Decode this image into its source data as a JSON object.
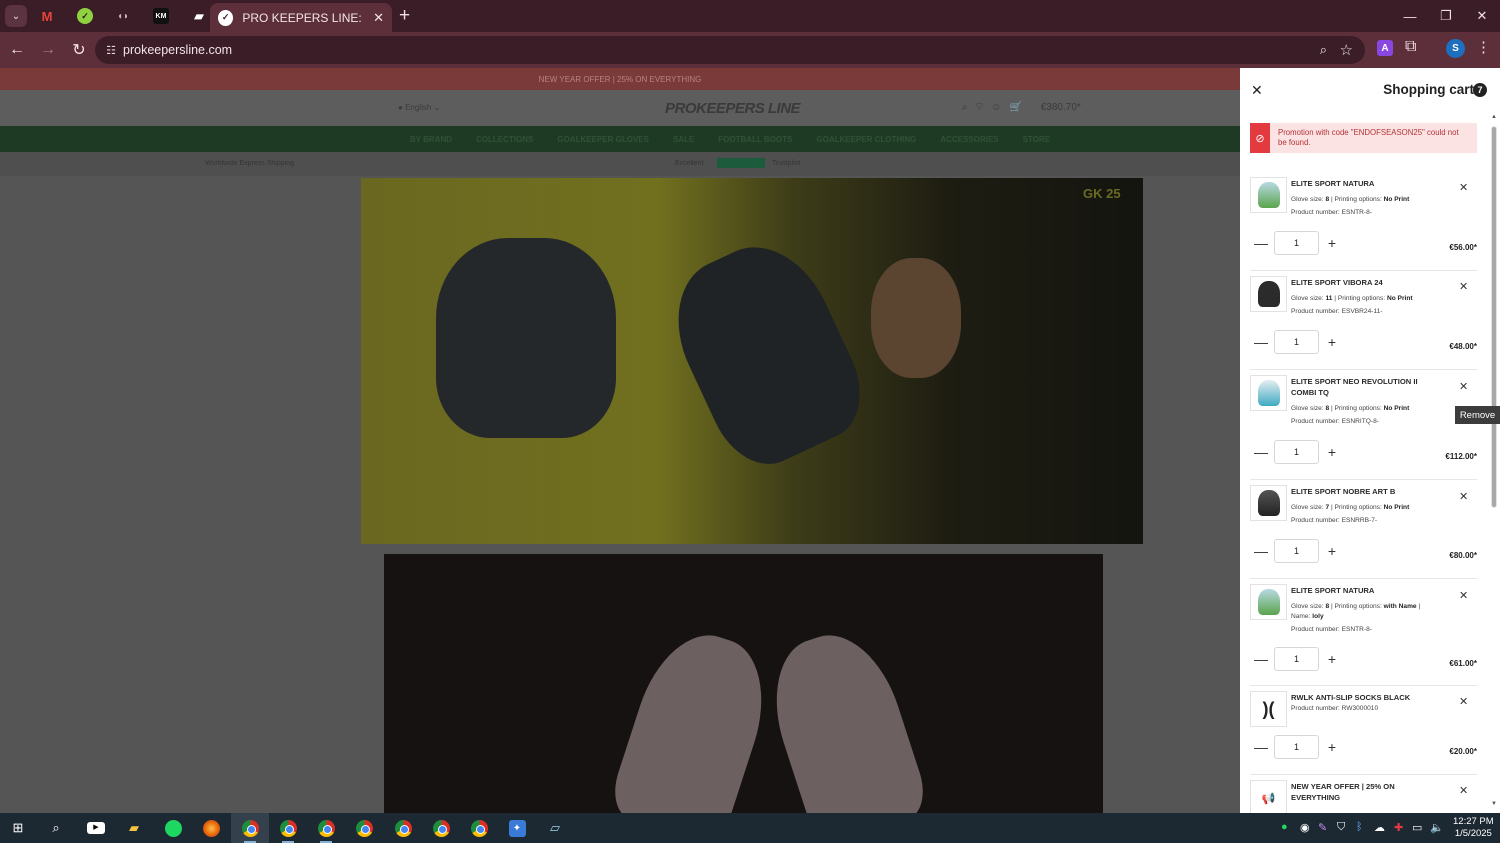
{
  "browser": {
    "active_tab_title": "PRO KEEPERS LINE: Goalkeeper",
    "url": "prokeepersline.com",
    "profile_initial": "S",
    "extension_letter": "A",
    "pinned_tabs": [
      {
        "icon": "gmail-icon",
        "label": "M"
      },
      {
        "icon": "check-icon",
        "label": "✓"
      },
      {
        "icon": "audio-icon",
        "label": "◖◗"
      },
      {
        "icon": "km-icon",
        "label": "KM"
      },
      {
        "icon": "claper-icon",
        "label": "▰"
      }
    ]
  },
  "page": {
    "promo_bar": "NEW YEAR OFFER | 25% ON EVERYTHING",
    "language": "English",
    "logo": "PROKEEPERS LINE",
    "cart_total": "€380.70*",
    "nav": [
      "BY BRAND",
      "COLLECTIONS",
      "GOALKEEPER GLOVES",
      "SALE",
      "FOOTBALL BOOTS",
      "GOALKEEPER CLOTHING",
      "ACCESSORIES",
      "STORE"
    ],
    "usp_shipping": "Worldwide Express Shipping",
    "usp_rating": "Excellent",
    "usp_trustpilot": "Trustpilot",
    "hero_badge": "GK 25"
  },
  "cart": {
    "title": "Shopping cart",
    "count": "7",
    "alert": "Promotion with code \"ENDOFSEASON25\" could not be found.",
    "tooltip": "Remove",
    "items": [
      {
        "name": "ELITE SPORT NATURA",
        "opts_pre": "Glove size: ",
        "size": "8",
        "opts_mid": " | Printing options: ",
        "print": "No Print",
        "pn": "Product number: ESNTR-8-",
        "qty": "1",
        "price": "€56.00*",
        "glove_color": "#5aa44c"
      },
      {
        "name": "ELITE SPORT VIBORA 24",
        "opts_pre": "Glove size: ",
        "size": "11",
        "opts_mid": " | Printing options: ",
        "print": "No Print",
        "pn": "Product number: ESVBR24-11-",
        "qty": "1",
        "price": "€48.00*",
        "glove_color": "#2b2b2b"
      },
      {
        "name": "ELITE SPORT NEO REVOLUTION II COMBI TQ",
        "opts_pre": "Glove size: ",
        "size": "8",
        "opts_mid": " | Printing options: ",
        "print": "No Print",
        "pn": "Product number: ESNRITQ-8-",
        "qty": "1",
        "price": "€112.00*",
        "glove_color": "#3fa9c3"
      },
      {
        "name": "ELITE SPORT NOBRE ART B",
        "opts_pre": "Glove size: ",
        "size": "7",
        "opts_mid": " | Printing options: ",
        "print": "No Print",
        "pn": "Product number: ESNRRB-7-",
        "qty": "1",
        "price": "€80.00*",
        "glove_color": "#333333"
      },
      {
        "name": "ELITE SPORT NATURA",
        "opts_pre": "Glove size: ",
        "size": "8",
        "opts_mid": " | Printing options: ",
        "print": "with Name",
        "opts_extra": " | Name: ",
        "extra_val": "loly",
        "pn": "Product number: ESNTR-8-",
        "qty": "1",
        "price": "€61.00*",
        "glove_color": "#5aa44c"
      },
      {
        "name": "RWLK ANTI-SLIP SOCKS BLACK",
        "pn": "Product number: RW3000010",
        "qty": "1",
        "price": "€20.00*"
      },
      {
        "name": "NEW YEAR OFFER | 25% ON EVERYTHING"
      }
    ]
  },
  "taskbar": {
    "time": "12:27 PM",
    "date": "1/5/2025"
  },
  "colors": {
    "chrome_dark": "#3a1d26",
    "chrome_toolbar": "#5d2f3b",
    "alert_red": "#e23a3e",
    "alert_bg": "#fbe3e4",
    "nav_green": "#1f3a24"
  }
}
